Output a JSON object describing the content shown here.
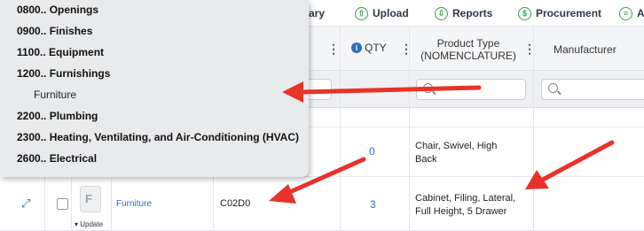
{
  "toolbar": {
    "library_label": "brary",
    "upload_label": "Upload",
    "reports_label": "Reports",
    "procurement_label": "Procurement",
    "more_label": "A",
    "upload_icon": "cloud-upload-icon",
    "reports_icon": "download-circle-icon",
    "procurement_icon": "dollar-circle-icon",
    "more_icon": "list-circle-icon",
    "icon_color": "#3aa04a"
  },
  "columns": {
    "qty": "QTY",
    "product_type_line1": "Product Type",
    "product_type_line2": "(NOMENCLATURE)",
    "manufacturer": "Manufacturer"
  },
  "dropdown": {
    "items": [
      {
        "label": "0800..  Openings"
      },
      {
        "label": "0900..  Finishes"
      },
      {
        "label": "1100..  Equipment"
      },
      {
        "label": "1200..  Furnishings"
      },
      {
        "label": "Furniture"
      },
      {
        "label": "2200..  Plumbing"
      },
      {
        "label": "2300..  Heating, Ventilating, and Air-Conditioning (HVAC)"
      },
      {
        "label": "2600..  Electrical"
      }
    ]
  },
  "rows": [
    {
      "qty": "0",
      "product_type_line1": "Chair, Swivel, High",
      "product_type_line2": "Back"
    },
    {
      "category": "Furniture",
      "code": "C02D0",
      "qty": "3",
      "product_type_line1": "Cabinet, Filing, Lateral,",
      "product_type_line2": "Full Height, 5 Drawer",
      "thumb_letter": "F",
      "update_label": "Update"
    }
  ],
  "colors": {
    "arrow": "#e8322a",
    "link": "#2a6ebb",
    "accent_green": "#3aa04a"
  }
}
